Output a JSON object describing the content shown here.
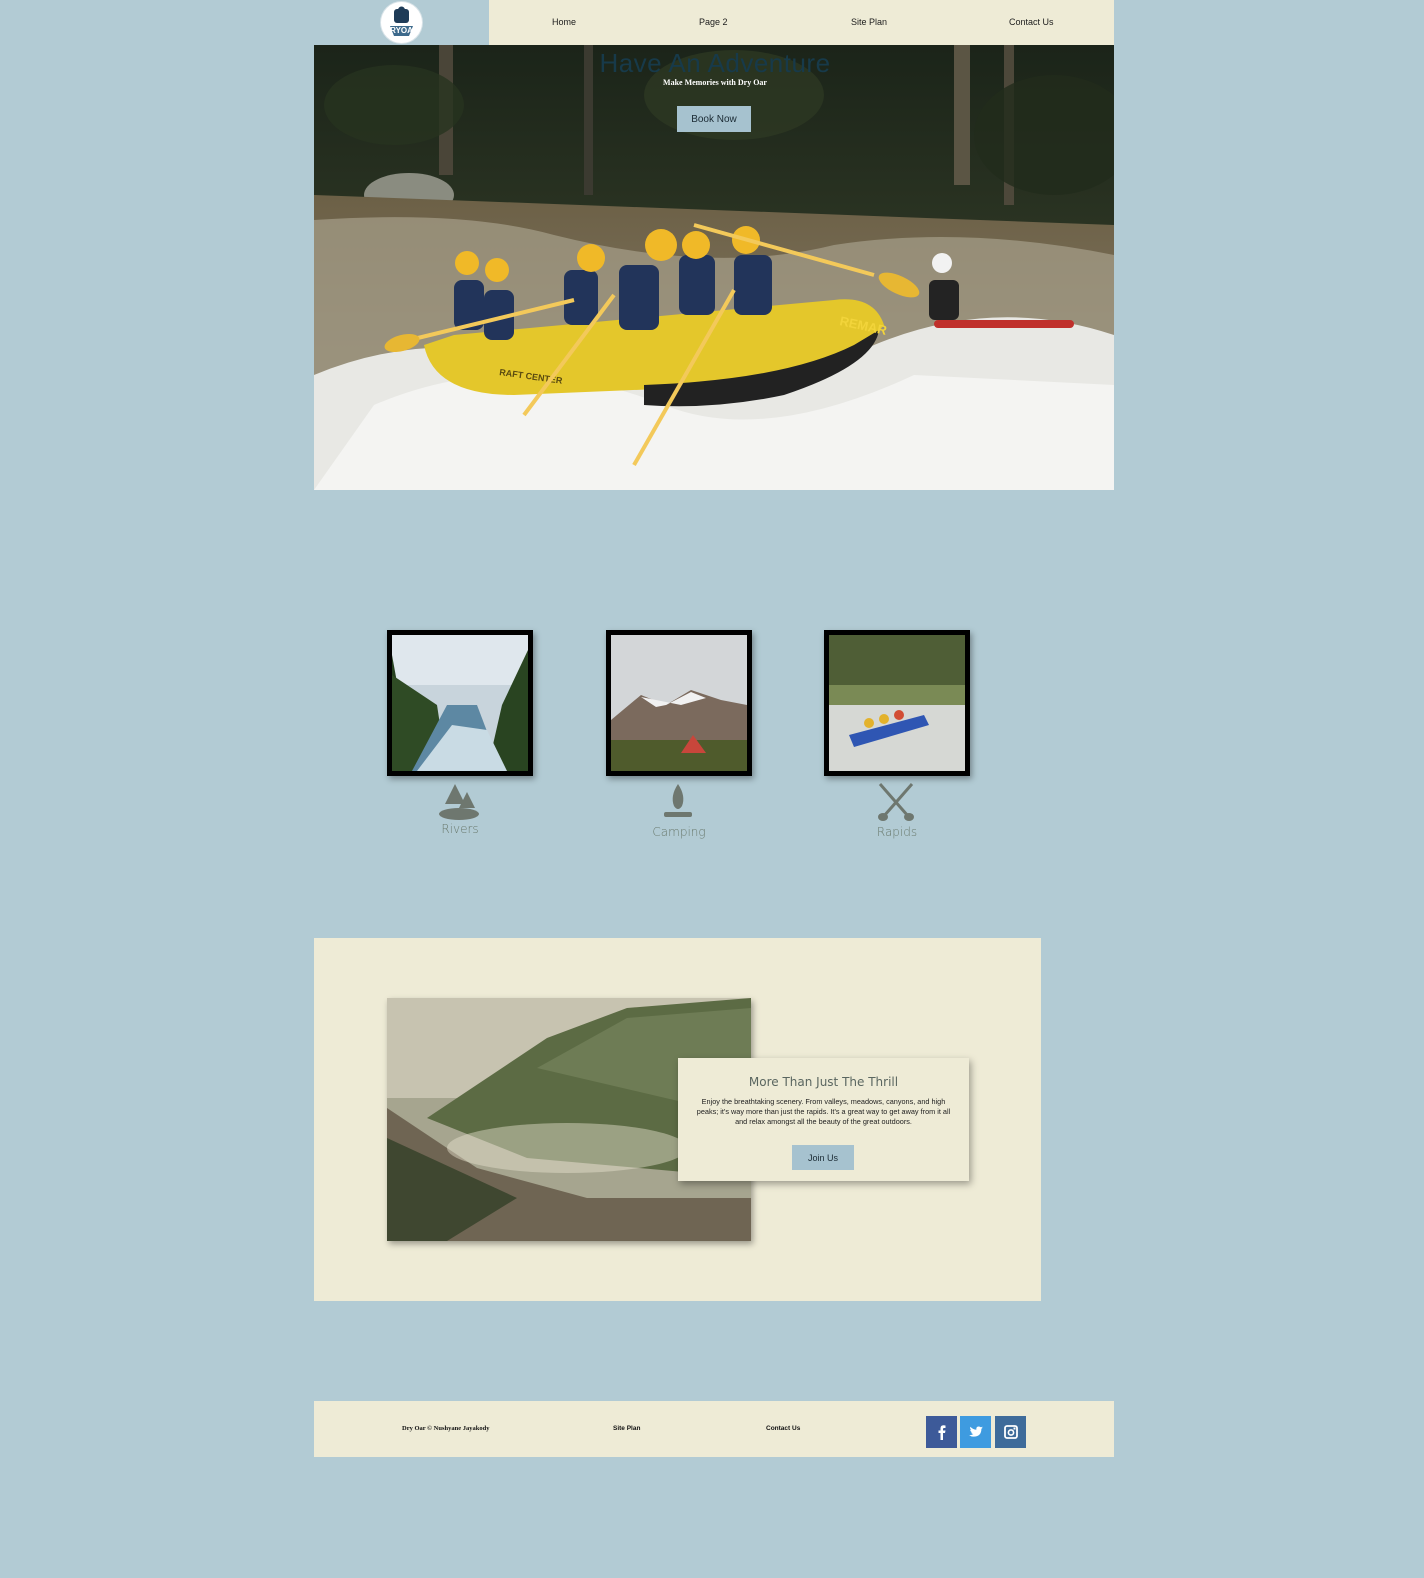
{
  "header": {
    "logo_text": "DRYOAR",
    "nav": [
      "Home",
      "Page 2",
      "Site Plan",
      "Contact Us"
    ]
  },
  "hero": {
    "title": "Have An Adventure",
    "subtitle": "Make Memories with Dry Oar",
    "button_label": "Book Now",
    "raft_brand": "REMAR",
    "raft_side_text": "RAFT CENTER"
  },
  "features": [
    {
      "label": "Rivers",
      "icon": "river-trees-icon"
    },
    {
      "label": "Camping",
      "icon": "campfire-icon"
    },
    {
      "label": "Rapids",
      "icon": "crossed-paddles-icon"
    }
  ],
  "thrill": {
    "title": "More Than Just The Thrill",
    "text": "Enjoy the breathtaking scenery. From valleys, meadows, canyons, and high peaks; it's way more than just the rapids. It's a great way to get away from it all and relax amongst all the beauty of the great outdoors.",
    "button_label": "Join Us"
  },
  "footer": {
    "copyright": "Dry Oar © Nushyane Jayakody",
    "site_plan": "Site Plan",
    "contact": "Contact Us",
    "social": [
      "facebook-icon",
      "twitter-icon",
      "instagram-icon"
    ]
  },
  "colors": {
    "page_bg": "#b2cbd4",
    "cream": "#eeebd6",
    "button": "#a6c2cf",
    "facebook": "#3d5a99",
    "twitter": "#3e9be0",
    "instagram": "#3e6b9a"
  }
}
